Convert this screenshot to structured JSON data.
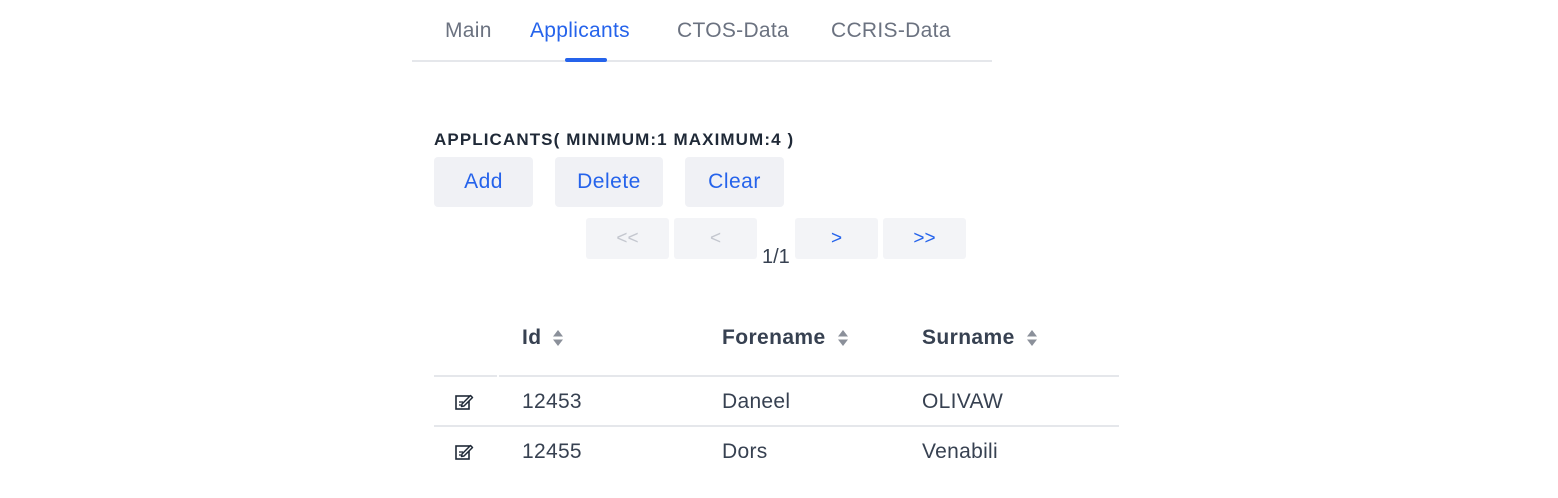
{
  "tabs": [
    {
      "label": "Main",
      "active": false
    },
    {
      "label": "Applicants",
      "active": true
    },
    {
      "label": "CTOS-Data",
      "active": false
    },
    {
      "label": "CCRIS-Data",
      "active": false
    }
  ],
  "section": {
    "title": "APPLICANTS( MINIMUM:1 MAXIMUM:4 )"
  },
  "actions": {
    "add_label": "Add",
    "delete_label": "Delete",
    "clear_label": "Clear"
  },
  "pagination": {
    "first_label": "<<",
    "prev_label": "<",
    "next_label": ">",
    "last_label": ">>",
    "page_info": "1/1"
  },
  "table": {
    "columns": [
      "Id",
      "Forename",
      "Surname"
    ],
    "rows": [
      {
        "id": "12453",
        "forename": "Daneel",
        "surname": "OLIVAW"
      },
      {
        "id": "12455",
        "forename": "Dors",
        "surname": "Venabili"
      }
    ]
  },
  "colors": {
    "accent": "#2563eb",
    "button_bg": "#f0f1f5",
    "disabled_text": "#c4c7cf",
    "divider": "#e5e7eb"
  },
  "icons": {
    "sort": "sort-icon",
    "edit": "edit-icon"
  }
}
